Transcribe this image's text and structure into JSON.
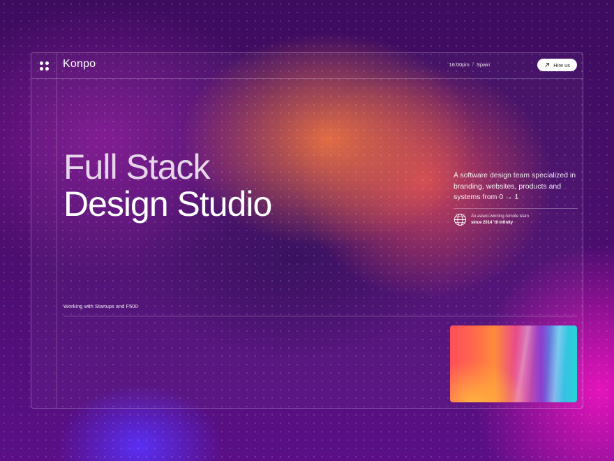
{
  "header": {
    "logo": "Konpo",
    "time": "16:00pm",
    "separator": "/",
    "location": "Spain",
    "hire_label": "Hire us"
  },
  "hero": {
    "headline_line1": "Full Stack",
    "headline_line2": "Design Studio",
    "description": "A software design team specialized in branding, websites, products and systems from 0 → 1",
    "award_line1": "An award-winning remote team",
    "award_line2": "since 2014 'til infinity"
  },
  "footer_note": "Working with Startups and F500",
  "icons": {
    "menu": "menu-dots-icon",
    "hire": "arrow-up-right-icon",
    "award": "globe-icon"
  }
}
